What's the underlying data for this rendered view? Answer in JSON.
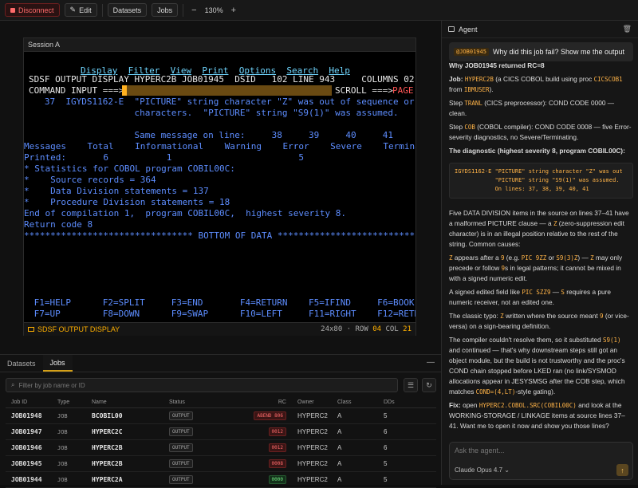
{
  "toolbar": {
    "disconnect_label": "Disconnect",
    "edit_label": "Edit",
    "datasets_label": "Datasets",
    "jobs_label": "Jobs",
    "zoom_out": "−",
    "zoom_level": "130%",
    "zoom_in": "+"
  },
  "session": {
    "title": "Session A",
    "menu": [
      "Display",
      "Filter",
      "View",
      "Print",
      "Options",
      "Search",
      "Help"
    ],
    "header_line": "SDSF OUTPUT DISPLAY HYPERC2B JOB01945  DSID   102 LINE 943     COLUMNS 02- 81",
    "command_label": "COMMAND INPUT ===>",
    "scroll_label": "SCROLL ===>",
    "scroll_value": "PAGE",
    "lines": [
      "   37  IGYDS1162-E  \"PICTURE\" string character \"Z\" was out of sequence or was",
      "                    characters.  \"PICTURE\" string \"S9(1)\" was assumed.",
      "",
      "                    Same message on line:     38     39     40     41",
      "Messages    Total    Informational    Warning    Error    Severe    Terminating",
      "Printed:       6           1                        5",
      "* Statistics for COBOL program COBIL00C:",
      "*    Source records = 364",
      "*    Data Division statements = 137",
      "*    Procedure Division statements = 18",
      "End of compilation 1,  program COBIL00C,  highest severity 8.",
      "Return code 8",
      "******************************** BOTTOM OF DATA ********************************"
    ],
    "pf_row1": " F1=HELP      F2=SPLIT     F3=END       F4=RETURN    F5=IFIND     F6=BOOK",
    "pf_row2": " F7=UP        F8=DOWN      F9=SWAP      F10=LEFT     F11=RIGHT    F12=RETRIEVE",
    "status_label": "SDSF OUTPUT DISPLAY",
    "status_size": "24x80",
    "status_row_label": "ROW",
    "status_row": "04",
    "status_col_label": "COL",
    "status_col": "21"
  },
  "jobs_panel": {
    "tabs": [
      "Datasets",
      "Jobs"
    ],
    "minimize": "—",
    "filter_placeholder": "Filter by job name or ID",
    "columns": [
      "Job ID",
      "Type",
      "Name",
      "Status",
      "RC",
      "Owner",
      "Class",
      "DDs"
    ],
    "rows": [
      {
        "id": "JOB01948",
        "type": "JOB",
        "name": "BCOBIL00",
        "status": "OUTPUT",
        "rc": "ABEND 806",
        "rc_ok": false,
        "owner": "HYPERC2",
        "class": "A",
        "dds": "5"
      },
      {
        "id": "JOB01947",
        "type": "JOB",
        "name": "HYPERC2C",
        "status": "OUTPUT",
        "rc": "0012",
        "rc_ok": false,
        "owner": "HYPERC2",
        "class": "A",
        "dds": "6"
      },
      {
        "id": "JOB01946",
        "type": "JOB",
        "name": "HYPERC2B",
        "status": "OUTPUT",
        "rc": "0012",
        "rc_ok": false,
        "owner": "HYPERC2",
        "class": "A",
        "dds": "6"
      },
      {
        "id": "JOB01945",
        "type": "JOB",
        "name": "HYPERC2B",
        "status": "OUTPUT",
        "rc": "0008",
        "rc_ok": false,
        "owner": "HYPERC2",
        "class": "A",
        "dds": "5"
      },
      {
        "id": "JOB01944",
        "type": "JOB",
        "name": "HYPERC2A",
        "status": "OUTPUT",
        "rc": "0000",
        "rc_ok": true,
        "owner": "HYPERC2",
        "class": "A",
        "dds": "5"
      }
    ]
  },
  "agent": {
    "title": "Agent",
    "user_chip": "@JOB01945",
    "user_text": "Why did this job fail? Show me the output",
    "answer_title": "Why JOB01945 returned RC=8",
    "job_prefix": "Job:",
    "job_name": "HYPERC2B",
    "job_mid": "(a CICS COBOL build using proc",
    "job_proc": "CICSCOB1",
    "job_from": "from",
    "job_lib": "IBMUSER",
    "job_end": ").",
    "step1_prefix": "Step",
    "step1_name": "TRANL",
    "step1_text": "(CICS preprocessor): COND CODE 0000 — clean.",
    "step2_prefix": "Step",
    "step2_name": "COB",
    "step2_text": "(COBOL compiler): COND CODE 0008 — five Error-severity diagnostics, no Severe/Terminating.",
    "diag_title": "The diagnostic (highest severity 8, program COBIL00C):",
    "codeblock": "IGYDS1162-E \"PICTURE\" string character \"Z\" was out\n            \"PICTURE\" string \"S9(1)\" was assumed.\n            On lines: 37, 38, 39, 40, 41",
    "p1": "Five DATA DIVISION items in the source on lines 37–41 have a malformed PICTURE clause — a",
    "p1_code": "Z",
    "p1_end": "(zero-suppression edit character) is in an illegal position relative to the rest of the string. Common causes:",
    "c1_code": "Z",
    "c1_a": "appears after a",
    "c1_b": "9",
    "c1_c": "(e.g.",
    "c1_d": "PIC 9ZZ",
    "c1_e": "or",
    "c1_f": "S9(3)Z",
    "c1_g": ") —",
    "c1_h": "Z",
    "c1_i": "may only precede or follow",
    "c1_j": "9",
    "c1_k": "s in legal patterns; it cannot be mixed in with a signed numeric edit.",
    "c2_a": "A signed edited field like",
    "c2_b": "PIC SZZ9",
    "c2_c": "—",
    "c2_d": "S",
    "c2_e": "requires a pure numeric receiver, not an edited one.",
    "c3_a": "The classic typo:",
    "c3_b": "Z",
    "c3_c": "written where the source meant",
    "c3_d": "9",
    "c3_e": "(or vice-versa) on a sign-bearing definition.",
    "p2_a": "The compiler couldn't resolve them, so it substituted",
    "p2_b": "S9(1)",
    "p2_c": "and continued — that's why downstream steps still got an object module, but the build is not trustworthy and the proc's COND chain stopped before LKED ran (no link/SYSMOD allocations appear in JESYSMSG after the COB step, which matches",
    "p2_d": "COND=(4,LT)",
    "p2_e": "-style gating).",
    "fix_label": "Fix:",
    "fix_a": "open",
    "fix_b": "HYPERC2.COBOL.SRC(COBIL00C)",
    "fix_c": "and look at the WORKING-STORAGE / LINKAGE items at source lines 37–41. Want me to open it now and show you those lines?",
    "composer_placeholder": "Ask the agent...",
    "model": "Claude Opus 4.7 ⌄",
    "send_icon": "↑"
  }
}
